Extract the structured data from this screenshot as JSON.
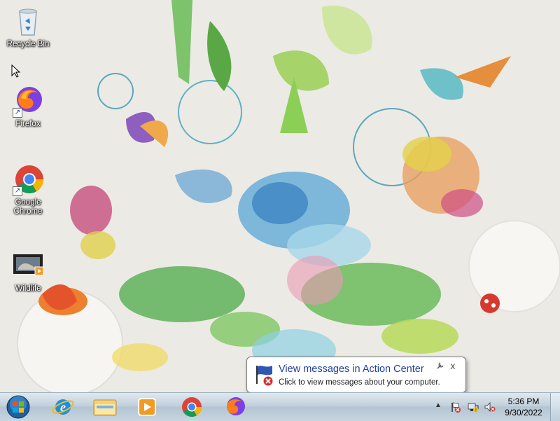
{
  "desktop": {
    "icons": [
      {
        "label": "Recycle Bin",
        "icon": "recycle-bin-icon"
      },
      {
        "label": "Firefox",
        "icon": "firefox-icon",
        "shortcut": true
      },
      {
        "label": "Google Chrome",
        "icon": "chrome-icon",
        "shortcut": true
      },
      {
        "label": "Wildlife",
        "icon": "video-file-icon"
      }
    ],
    "wallpaper": "floral-illustration"
  },
  "notification": {
    "title": "View messages in Action Center",
    "body": "Click to view messages about your computer.",
    "close_glyph": "x"
  },
  "taskbar": {
    "pinned": [
      "internet-explorer",
      "windows-explorer",
      "windows-media-player",
      "google-chrome",
      "firefox"
    ],
    "tray_arrow": "▲",
    "clock": {
      "time": "5:36 PM",
      "date": "9/30/2022"
    }
  },
  "colors": {
    "balloon_title": "#1e3f9e",
    "taskbar": "#c3d1dc"
  }
}
